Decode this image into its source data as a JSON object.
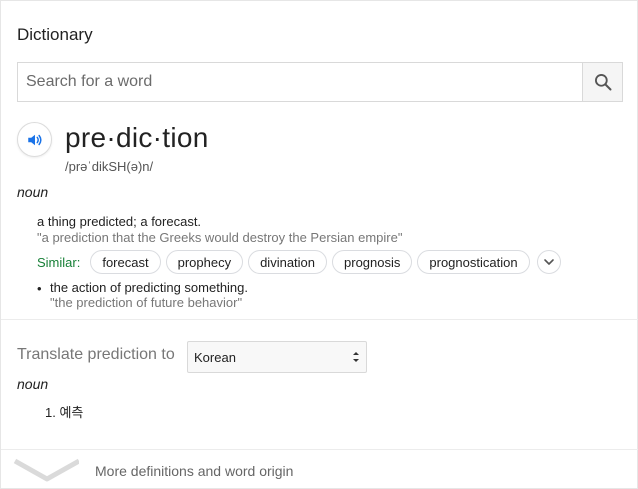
{
  "panel": {
    "title": "Dictionary"
  },
  "search": {
    "placeholder": "Search for a word",
    "value": ""
  },
  "entry": {
    "headword": "pre·dic·tion",
    "phonetic": "/prəˈdikSH(ə)n/",
    "part_of_speech": "noun",
    "senses": [
      {
        "definition": "a thing predicted; a forecast.",
        "example": "\"a prediction that the Greeks would destroy the Persian empire\"",
        "similar_label": "Similar:",
        "similar": [
          "forecast",
          "prophecy",
          "divination",
          "prognosis",
          "prognostication"
        ]
      },
      {
        "bullet": "•",
        "definition": "the action of predicting something.",
        "example": "\"the prediction of future behavior\""
      }
    ]
  },
  "translate": {
    "label": "Translate prediction to",
    "language": "Korean",
    "part_of_speech": "noun",
    "items": [
      "1. 예측"
    ]
  },
  "footer": {
    "more_label": "More definitions and word origin"
  },
  "colors": {
    "similar_label": "#188038",
    "speaker_icon": "#1a73e8"
  },
  "icons": {
    "search": "search-icon",
    "speaker": "speaker-icon",
    "more": "chevron-down-icon"
  }
}
